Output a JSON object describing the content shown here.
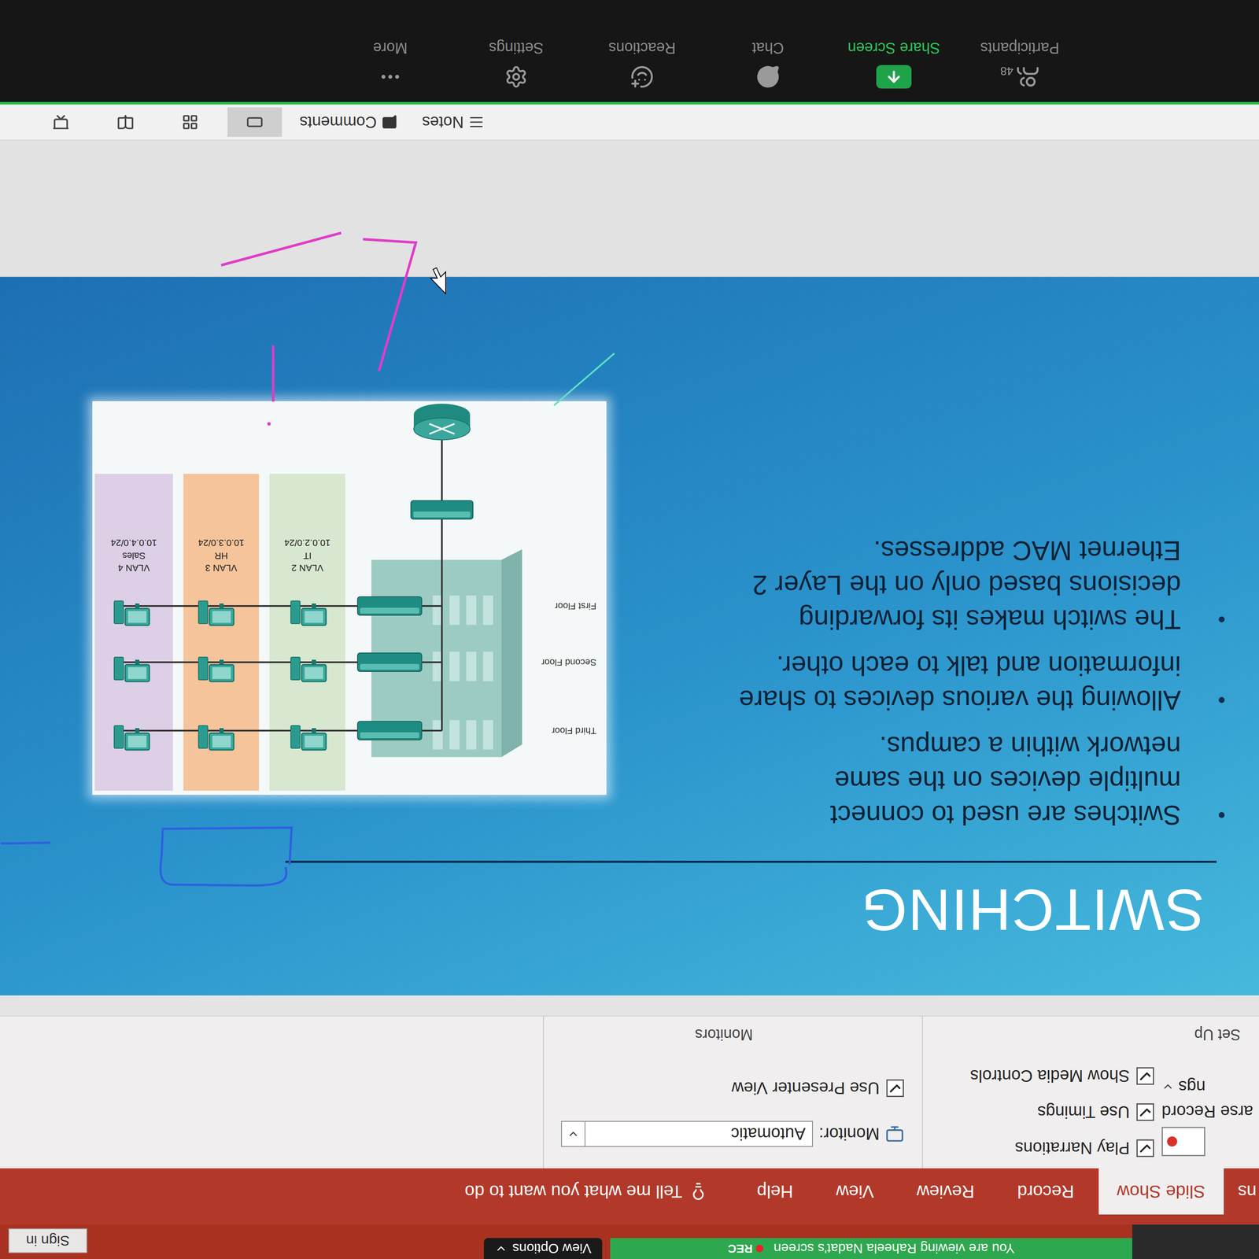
{
  "zoom_banner": {
    "text": "You are viewing Raheela Nadat's screen",
    "rec": "REC",
    "view_options": "View Options"
  },
  "title_bar": {
    "sign_in": "Sign in"
  },
  "ribbon": {
    "tabs": [
      {
        "label": "ns",
        "selected": false
      },
      {
        "label": "Slide Show",
        "selected": true
      },
      {
        "label": "Record",
        "selected": false
      },
      {
        "label": "Review",
        "selected": false
      },
      {
        "label": "View",
        "selected": false
      },
      {
        "label": "Help",
        "selected": false
      }
    ],
    "tell_me": "Tell me what you want to do",
    "setup_group": {
      "label": "Set Up",
      "record_button": "arse Record",
      "settings_button": "ngs",
      "checkboxes": [
        {
          "label": "Play Narrations",
          "checked": true
        },
        {
          "label": "Use Timings",
          "checked": true
        },
        {
          "label": "Show Media Controls",
          "checked": true
        }
      ]
    },
    "monitors_group": {
      "label": "Monitors",
      "monitor_label": "Monitor:",
      "monitor_value": "Automatic",
      "presenter_view": {
        "label": "Use Presenter View",
        "checked": true
      }
    }
  },
  "slide": {
    "title": "SWITCHING",
    "bullets": [
      {
        "lines": [
          "Switches are used to connect",
          "multiple devices on the same",
          "network within a campus."
        ]
      },
      {
        "lines": [
          "Allowing the various devices to share",
          "information and talk to each other."
        ]
      },
      {
        "lines": [
          "The switch makes its forwarding",
          "decisions based only on the Layer 2",
          "Ethernet MAC addresses."
        ]
      }
    ],
    "diagram": {
      "floors": [
        "Third Floor",
        "Second Floor",
        "First Floor"
      ],
      "vlans": [
        {
          "name": "VLAN 2",
          "dept": "IT",
          "subnet": "10.0.2.0/24",
          "color": "#d8e8d0"
        },
        {
          "name": "VLAN 3",
          "dept": "HR",
          "subnet": "10.0.3.0/24",
          "color": "#f6c49a"
        },
        {
          "name": "VLAN 4",
          "dept": "Sales",
          "subnet": "10.0.4.0/24",
          "color": "#dccfe6"
        }
      ]
    }
  },
  "status_bar": {
    "notes": "Notes",
    "comments": "Comments",
    "views": [
      {
        "kind": "normal",
        "selected": true
      },
      {
        "kind": "sorter",
        "selected": false
      },
      {
        "kind": "reading",
        "selected": false
      },
      {
        "kind": "slideshow",
        "selected": false
      }
    ]
  },
  "zoom_toolbar": {
    "items": [
      {
        "kind": "participants",
        "label": "Participants",
        "count": "48",
        "active": false
      },
      {
        "kind": "share",
        "label": "Share Screen",
        "active": true
      },
      {
        "kind": "chat",
        "label": "Chat",
        "active": false
      },
      {
        "kind": "reactions",
        "label": "Reactions",
        "active": false
      },
      {
        "kind": "settings",
        "label": "Settings",
        "active": false
      },
      {
        "kind": "more",
        "label": "More",
        "active": false
      }
    ]
  }
}
